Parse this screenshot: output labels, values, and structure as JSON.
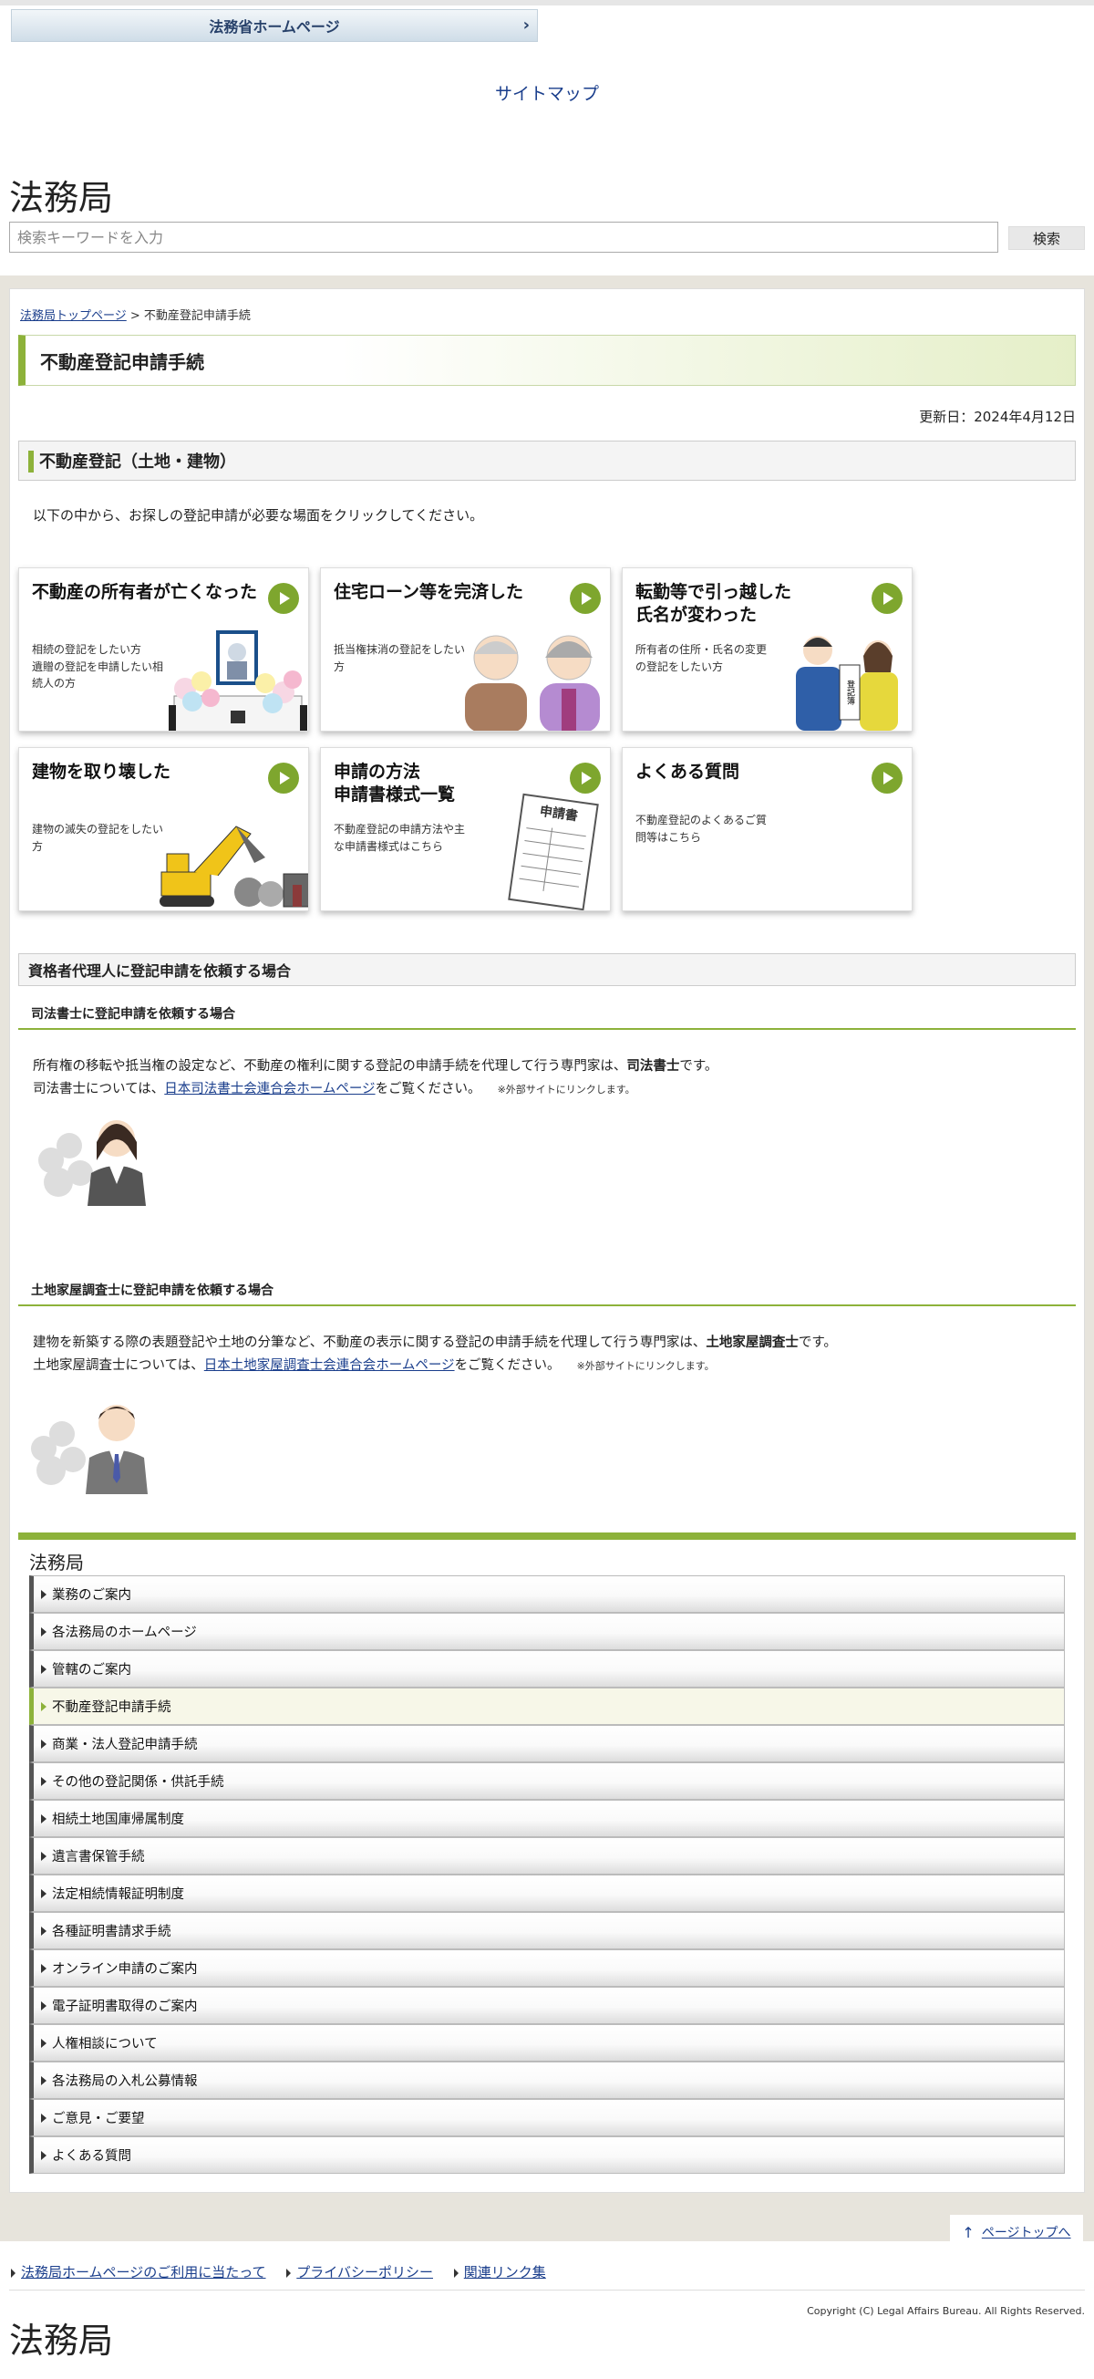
{
  "header": {
    "moj_link_label": "法務省ホームページ",
    "sitemap_label": "サイトマップ",
    "site_title": "法務局",
    "search_placeholder": "検索キーワードを入力",
    "search_button": "検索"
  },
  "breadcrumb": {
    "home": "法務局トップページ",
    "separator": " > ",
    "current": "不動産登記申請手続"
  },
  "page": {
    "title": "不動産登記申請手続",
    "updated": "更新日：2024年4月12日",
    "section_title": "不動産登記（土地・建物）",
    "intro": "以下の中から、お探しの登記申請が必要な場面をクリックしてください。"
  },
  "cards": [
    {
      "title": "不動産の所有者が亡くなった",
      "desc": "相続の登記をしたい方\n遺贈の登記を申請したい相\n続人の方"
    },
    {
      "title": "住宅ローン等を完済した",
      "desc": "抵当権抹消の登記をしたい\n方"
    },
    {
      "title": "転勤等で引っ越した\n氏名が変わった",
      "desc": "所有者の住所・氏名の変更\nの登記をしたい方"
    },
    {
      "title": "建物を取り壊した",
      "desc": "建物の滅失の登記をしたい\n方"
    },
    {
      "title": "申請の方法\n申請書様式一覧",
      "desc": "不動産登記の申請方法や主\nな申請書様式はこちら"
    },
    {
      "title": "よくある質問",
      "desc": "不動産登記のよくあるご質\n問等はこちら"
    }
  ],
  "illustration_labels": {
    "application_form": "申請書",
    "certificate": "登記簿"
  },
  "agent_section": {
    "title": "資格者代理人に登記申請を依頼する場合",
    "shiho": {
      "heading": "司法書士に登記申請を依頼する場合",
      "line1_a": "所有権の移転や抵当権の設定など、不動産の権利に関する登記の申請手続を代理して行う専門家は、",
      "line1_bold": "司法書士",
      "line1_b": "です。",
      "line2_a": "司法書士については、",
      "line2_link": "日本司法書士会連合会ホームページ",
      "line2_b": "をご覧ください。",
      "external_note": "※外部サイトにリンクします。"
    },
    "tochi": {
      "heading": "土地家屋調査士に登記申請を依頼する場合",
      "line1_a": "建物を新築する際の表題登記や土地の分筆など、不動産の表示に関する登記の申請手続を代理して行う専門家は、",
      "line1_bold": "土地家屋調査士",
      "line1_b": "です。",
      "line2_a": "土地家屋調査士については、",
      "line2_link": "日本土地家屋調査士会連合会ホームページ",
      "line2_b": "をご覧ください。",
      "external_note": "※外部サイトにリンクします。"
    }
  },
  "footer_menu": {
    "title": "法務局",
    "items": [
      "業務のご案内",
      "各法務局のホームページ",
      "管轄のご案内",
      "不動産登記申請手続",
      "商業・法人登記申請手続",
      "その他の登記関係・供託手続",
      "相続土地国庫帰属制度",
      "遺言書保管手続",
      "法定相続情報証明制度",
      "各種証明書請求手続",
      "オンライン申請のご案内",
      "電子証明書取得のご案内",
      "人権相談について",
      "各法務局の入札公募情報",
      "ご意見・ご要望",
      "よくある質問"
    ],
    "active_index": 3
  },
  "footer": {
    "pagetop": "ページトップへ",
    "links": [
      "法務局ホームページのご利用に当たって",
      "プライバシーポリシー",
      "関連リンク集"
    ],
    "copyright": "Copyright (C) Legal Affairs Bureau. All Rights Reserved.",
    "title": "法務局"
  },
  "colors": {
    "accent_green": "#8db23a",
    "play_green": "#7ea62e",
    "link_blue": "#1a3e8c"
  }
}
